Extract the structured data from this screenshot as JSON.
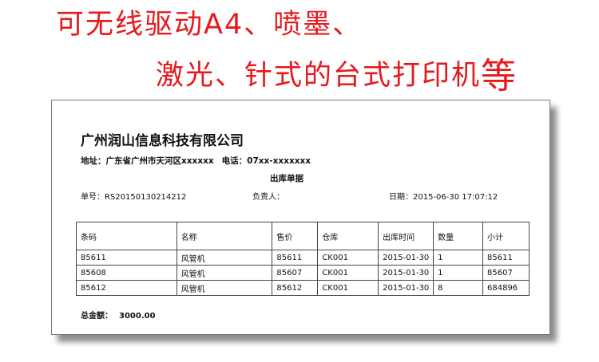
{
  "headline": {
    "line1": "可无线驱动A4、喷墨、",
    "line2_main": "激光、针式的台式打印机",
    "line2_big": "等"
  },
  "receipt": {
    "company": "广州润山信息科技有限公司",
    "address_label": "地址：",
    "address_value": "广东省广州市天河区xxxxxx",
    "phone_label": "电话：",
    "phone_value": "07xx-xxxxxxx",
    "title": "出库单据",
    "order_no_label": "单号：",
    "order_no": "RS20150130214212",
    "person_label": "负责人：",
    "person_value": "",
    "date_label": "日期：",
    "date_value": "2015-06-30 17:07:12",
    "columns": [
      "条码",
      "名称",
      "售价",
      "仓库",
      "出库时间",
      "数量",
      "小计"
    ],
    "rows": [
      [
        "85611",
        "风管机",
        "85611",
        "CK001",
        "2015-01-30",
        "1",
        "85611"
      ],
      [
        "85608",
        "风管机",
        "85607",
        "CK001",
        "2015-01-30",
        "1",
        "85607"
      ],
      [
        "85612",
        "风管机",
        "85612",
        "CK001",
        "2015-01-30",
        "8",
        "684896"
      ]
    ],
    "total_label": "总金额：",
    "total_value": "3000.00"
  },
  "colors": {
    "headline": "#e6191d",
    "paper_border": "#7a7a7a",
    "table_border": "#444444"
  }
}
